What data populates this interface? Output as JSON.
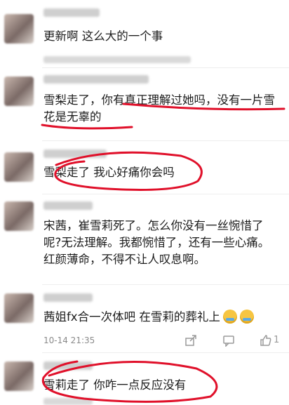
{
  "comments": [
    {
      "text": "更新啊 这么大的一个事"
    },
    {
      "text": "雪梨走了，你有真正理解过她吗，没有一片雪花是无辜的"
    },
    {
      "text": "雪梨走了 我心好痛你会吗"
    },
    {
      "text": "宋茜，崔雪莉死了。怎么你没有一丝惋惜了呢?无法理解。我都惋惜了，还有一些心痛。红颜薄命，不得不让人叹息啊。"
    },
    {
      "text": "茜姐fx合一次体吧 在雪莉的葬礼上",
      "time": "10-14 21:35",
      "like_count": "1"
    },
    {
      "text": "雪莉走了 你咋一点反应没有"
    }
  ],
  "icons": [
    "share-icon",
    "comment-icon",
    "like-icon",
    "crying-emoji-icon"
  ],
  "annotation_color": "#e0102a"
}
